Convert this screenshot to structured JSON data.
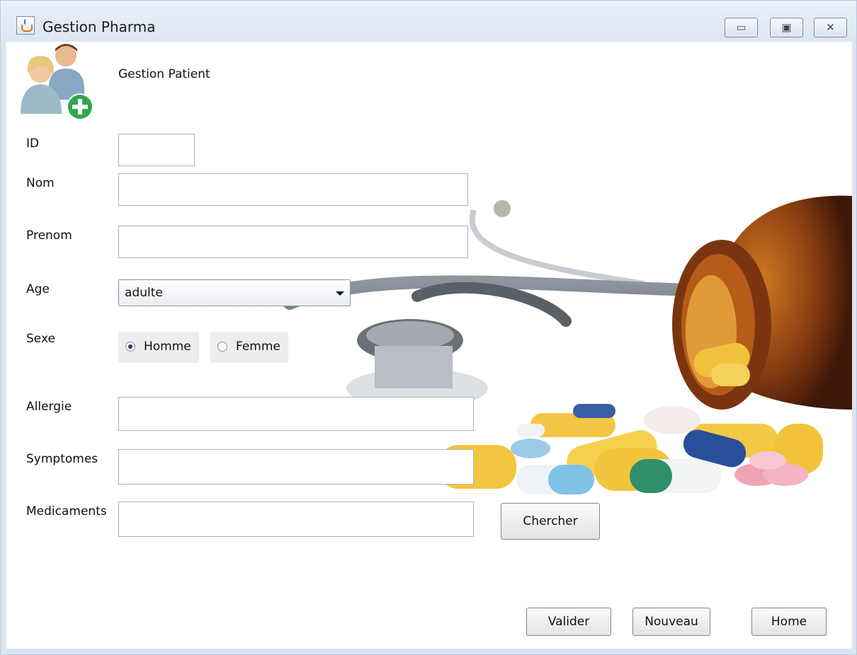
{
  "window": {
    "title": "Gestion Pharma",
    "controls": {
      "minimize": "▭",
      "maximize": "▣",
      "close": "✕"
    }
  },
  "header": {
    "title": "Gestion Patient",
    "avatar_icon": "patients-add-icon"
  },
  "form": {
    "id": {
      "label": "ID",
      "value": ""
    },
    "nom": {
      "label": "Nom",
      "value": ""
    },
    "prenom": {
      "label": "Prenom",
      "value": ""
    },
    "age": {
      "label": "Age",
      "selected": "adulte"
    },
    "sexe": {
      "label": "Sexe",
      "options": [
        {
          "label": "Homme",
          "selected": true
        },
        {
          "label": "Femme",
          "selected": false
        }
      ]
    },
    "allergie": {
      "label": "Allergie",
      "value": ""
    },
    "symptomes": {
      "label": "Symptomes",
      "value": ""
    },
    "medicaments": {
      "label": "Medicaments",
      "value": ""
    }
  },
  "buttons": {
    "chercher": "Chercher",
    "valider": "Valider",
    "nouveau": "Nouveau",
    "home": "Home"
  },
  "colors": {
    "titlebar": "#dce6f2",
    "accent_green": "#2fa84f"
  }
}
